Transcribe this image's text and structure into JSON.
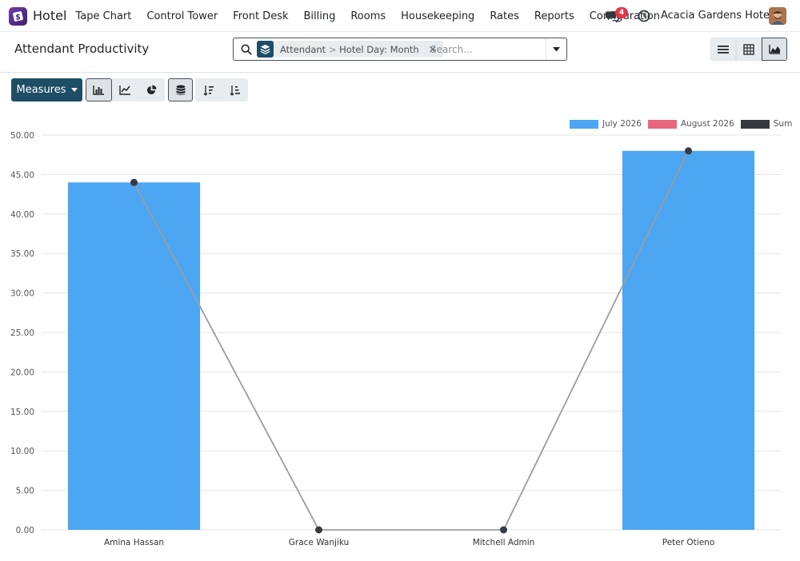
{
  "app": {
    "name": "Hotel",
    "menu": [
      "Tape Chart",
      "Control Tower",
      "Front Desk",
      "Billing",
      "Rooms",
      "Housekeeping",
      "Rates",
      "Reports",
      "Configuration"
    ],
    "notification_count": "4",
    "company": "Acacia Gardens Hotel"
  },
  "page": {
    "title": "Attendant Productivity"
  },
  "search": {
    "facet_group": "Attendant",
    "facet_separator": ">",
    "facet_value": "Hotel Day: Month",
    "placeholder": "Search..."
  },
  "toolbar": {
    "measures_label": "Measures"
  },
  "colors": {
    "brand": "#1e4e66",
    "bar_july": "#4da6f2",
    "bar_august": "#e8677e",
    "sum": "#343a40"
  },
  "chart_data": {
    "type": "bar",
    "categories": [
      "Amina Hassan",
      "Grace Wanjiku",
      "Mitchell Admin",
      "Peter Otieno"
    ],
    "series": [
      {
        "name": "July 2026",
        "type": "bar",
        "values": [
          44,
          0,
          0,
          48
        ]
      },
      {
        "name": "August 2026",
        "type": "bar",
        "values": [
          0,
          0,
          0,
          0
        ]
      },
      {
        "name": "Sum",
        "type": "line",
        "values": [
          44,
          0,
          0,
          48
        ]
      }
    ],
    "yticks": [
      "0.00",
      "5.00",
      "10.00",
      "15.00",
      "20.00",
      "25.00",
      "30.00",
      "35.00",
      "40.00",
      "45.00",
      "50.00"
    ],
    "ylim": [
      0,
      50
    ],
    "grid": true,
    "legend_position": "top-right"
  }
}
